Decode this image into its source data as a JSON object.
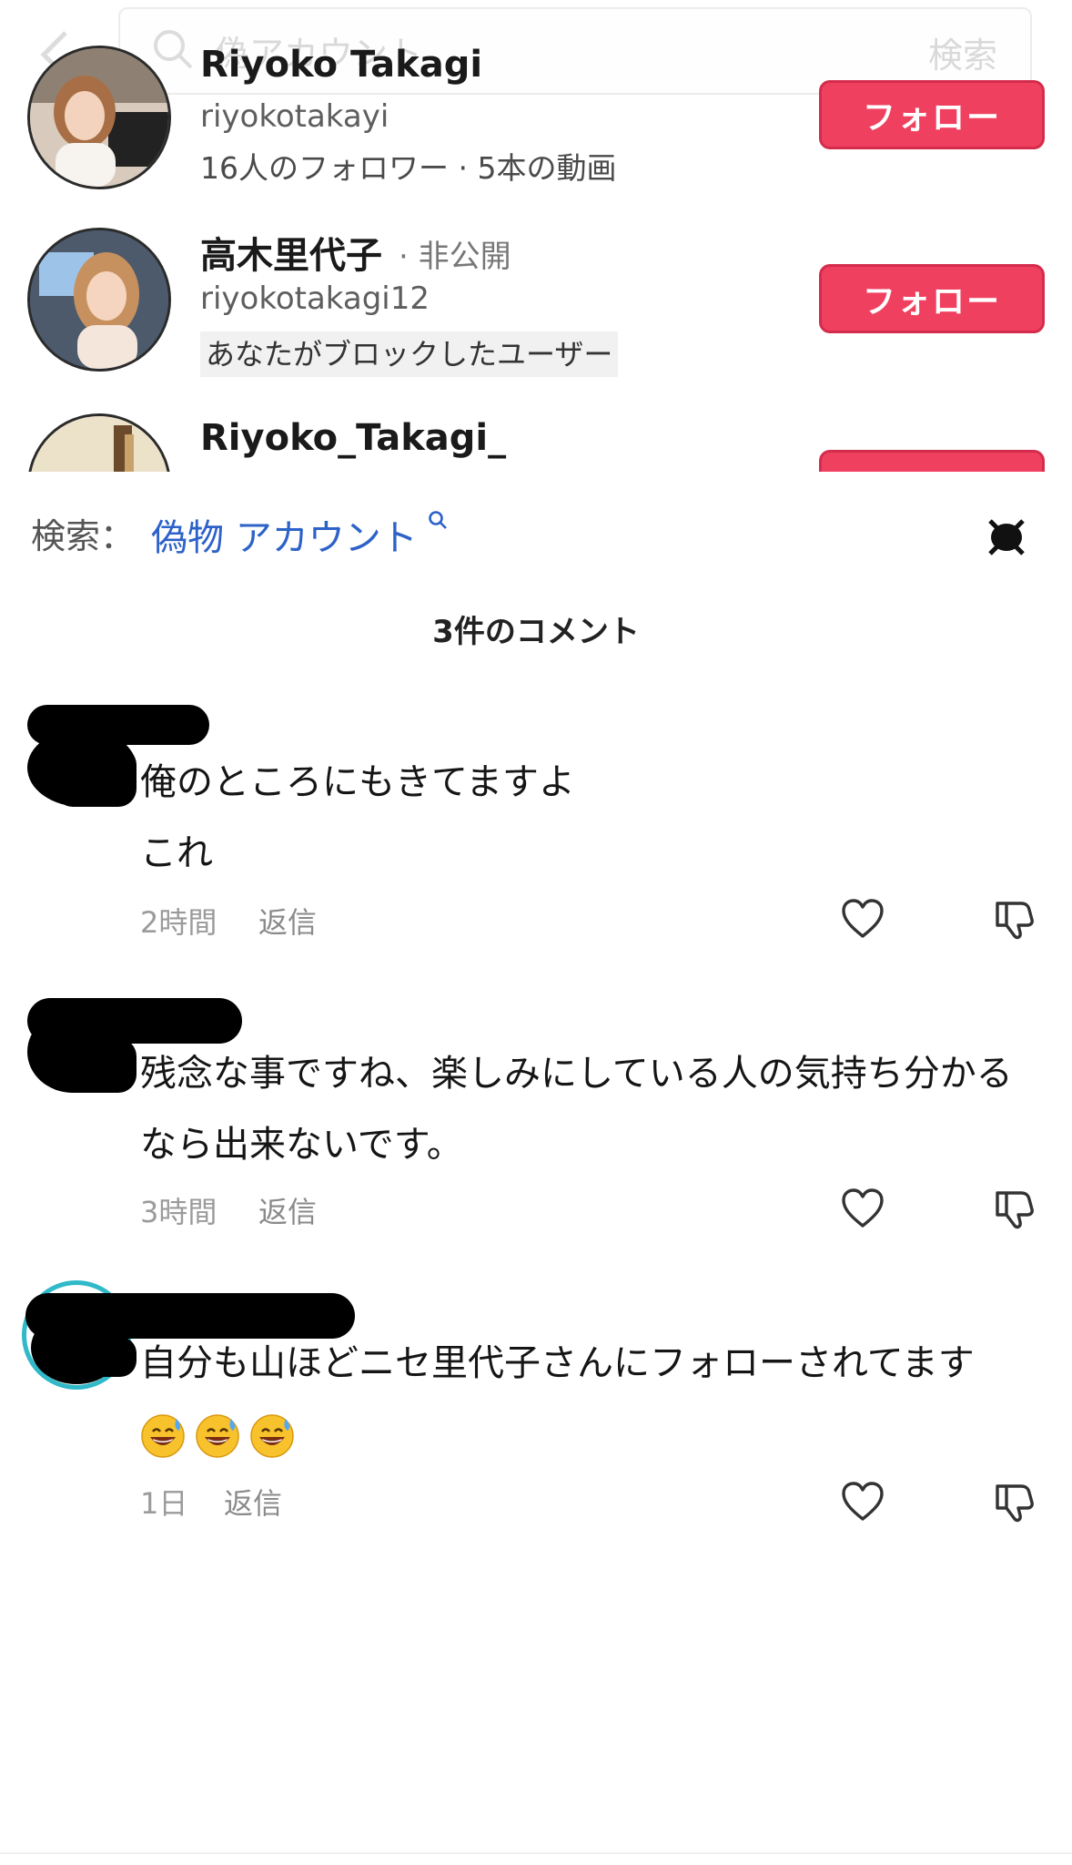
{
  "embedded_screenshot": {
    "search_query": "偽アカウント",
    "search_button": "検索",
    "accounts": [
      {
        "name": "Riyoko Takagi",
        "handle": "riyokotakayi",
        "meta": "16人のフォロワー · 5本の動画",
        "follow_label": "フォロー"
      },
      {
        "name": "高木里代子",
        "privacy": " · 非公開",
        "handle": "riyokotakagi12",
        "blocked_note": "あなたがブロックしたユーザー",
        "follow_label": "フォロー"
      },
      {
        "name": "Riyoko_Takagi_"
      }
    ]
  },
  "search_hint": {
    "label": "検索：",
    "query": "偽物 アカウント"
  },
  "comments_header": "3件のコメント",
  "comments": [
    {
      "lines": [
        "俺のところにもきてますよ",
        "これ"
      ],
      "time": "2時間",
      "reply": "返信"
    },
    {
      "lines": [
        "残念な事ですね、楽しみにしている人の気持ち分かる",
        "なら出来ないです。"
      ],
      "time": "3時間",
      "reply": "返信"
    },
    {
      "lines": [
        "自分も山ほどニセ里代子さんにフォローされてます"
      ],
      "emoji": "😅😅😅",
      "time": "1日",
      "reply": "返信"
    }
  ],
  "icons": {
    "back": "chevron-left-icon",
    "search": "search-icon",
    "close": "close-icon",
    "like": "heart-icon",
    "dislike": "dislike-icon",
    "emoji": "sweat-smile-emoji"
  },
  "colors": {
    "follow_button": "#f0405f",
    "link": "#2d62c8",
    "muted": "#9b9b9b"
  }
}
